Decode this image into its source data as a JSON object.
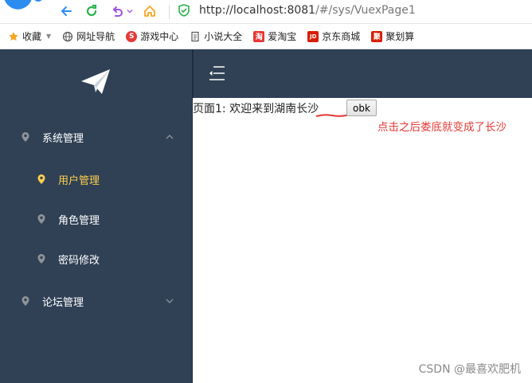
{
  "browser": {
    "url_host": "http://localhost:8081",
    "url_path": "/#/sys/VuexPage1"
  },
  "bookmarks": [
    {
      "label": "收藏",
      "icon": "star-icon",
      "color": "#f5a623"
    },
    {
      "label": "网址导航",
      "icon": "globe-icon",
      "color": "#555555"
    },
    {
      "label": "游戏中心",
      "icon": "game-icon",
      "color": "#e53935"
    },
    {
      "label": "小说大全",
      "icon": "book-icon",
      "color": "#555555"
    },
    {
      "label": "爱淘宝",
      "icon": "taobao-icon",
      "color": "#e53935",
      "glyph": "淘"
    },
    {
      "label": "京东商城",
      "icon": "jd-icon",
      "color": "#d81e06",
      "glyph": "JD"
    },
    {
      "label": "聚划算",
      "icon": "juhuasuan-icon",
      "color": "#d81e06",
      "glyph": "聚"
    }
  ],
  "sidebar": {
    "items": [
      {
        "label": "系统管理",
        "active": false
      },
      {
        "label": "用户管理",
        "active": true
      },
      {
        "label": "角色管理",
        "active": false
      },
      {
        "label": "密码修改",
        "active": false
      },
      {
        "label": "论坛管理",
        "active": false
      }
    ]
  },
  "content": {
    "greeting": "页面1:  欢迎来到湖南长沙",
    "button_label": "obk",
    "annotation": "点击之后娄底就变成了长沙"
  },
  "watermark": "CSDN @最喜欢肥机",
  "colors": {
    "sidebar_bg": "#304156",
    "active_text": "#ffd04b",
    "annotation": "#e53935"
  }
}
